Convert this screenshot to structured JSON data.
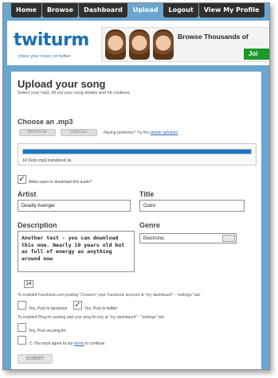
{
  "nav": {
    "items": [
      {
        "label": "Home"
      },
      {
        "label": "Browse"
      },
      {
        "label": "Dashboard"
      },
      {
        "label": "Upload",
        "active": true
      },
      {
        "label": "Logout"
      },
      {
        "label": "View My Profile"
      }
    ]
  },
  "header": {
    "logo_part1": "twit",
    "logo_part2": "urm",
    "tagline": "share your music on twitter",
    "ad_text": "Browse Thousands of",
    "ad_button": "Joi"
  },
  "upload": {
    "title": "Upload your song",
    "subtitle": "Select your mp3, fill out your song details and hit continue.",
    "choose_label": "Choose an .mp3",
    "browse_button": "BROWSE",
    "cancel_button": "CANCEL",
    "problem_text": "Having problems? Try the",
    "simple_uploader_link": "simple uploader",
    "progress_percent": 100,
    "progress_text": "14 Outro.mp3 transfered ok.",
    "allow_download_label": "Allow users to download this audio?",
    "allow_download_checked": true,
    "artist_label": "Artist",
    "artist_value": "Deadly Avenger",
    "title_label": "Title",
    "title_value": "Outro",
    "description_label": "Description",
    "description_value": "Another test - you can download\nthis one. Nearly 10 years old but\nas full of energy as anything\naround now",
    "genre_label": "Genre",
    "genre_value": "Electronic",
    "char_count": "14",
    "facebook_note": "To enabled Facebook.com posting \"Connect\" your Facebook account at \"my dashboard\" - \"settings\" tab.",
    "post_facebook_label": "Yes, Post to facebook",
    "post_facebook_checked": false,
    "post_twitter_label": "Yes, Post to twitter",
    "post_twitter_checked": true,
    "pingfm_note": "To enabled Ping.fm posting add your ping.fm key at \"my dashboard\" - \"settings\" tab.",
    "post_pingfm_label": "Yes, Post via ping.fm",
    "post_pingfm_checked": false,
    "terms_prefix": "You must agree to our",
    "terms_link": "terms",
    "terms_suffix": "to continue.",
    "terms_checked": false,
    "submit_button": "SUBMIT"
  },
  "colors": {
    "background": "#6aa6cf",
    "nav_dark": "#2f2f2f",
    "progress": "#1b78c8",
    "link": "#2a6db3",
    "warning": "#b12020"
  }
}
